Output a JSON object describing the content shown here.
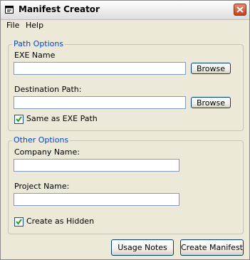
{
  "window": {
    "title": "Manifest Creator"
  },
  "menu": {
    "items": [
      "File",
      "Help"
    ]
  },
  "path_options": {
    "legend": "Path Options",
    "exe_name_label": "EXE Name",
    "exe_name_value": "",
    "browse_exe_label": "Browse",
    "destination_label": "Destination Path:",
    "destination_value": "",
    "browse_dest_label": "Browse",
    "same_as_exe_label": "Same as EXE Path",
    "same_as_exe_checked": true
  },
  "other_options": {
    "legend": "Other Options",
    "company_label": "Company Name:",
    "company_value": "",
    "project_label": "Project Name:",
    "project_value": "",
    "hidden_label": "Create as Hidden",
    "hidden_checked": true
  },
  "footer": {
    "usage_notes_label": "Usage Notes",
    "create_manifest_label": "Create Manifest"
  },
  "colors": {
    "legend": "#0046d5",
    "window_bg": "#ece9d8",
    "textbox_border": "#7f9db9",
    "close_button": "#c4411f",
    "checkmark": "#21a121"
  },
  "icons": {
    "app": "window-icon",
    "close": "close-icon",
    "check": "check-icon"
  }
}
